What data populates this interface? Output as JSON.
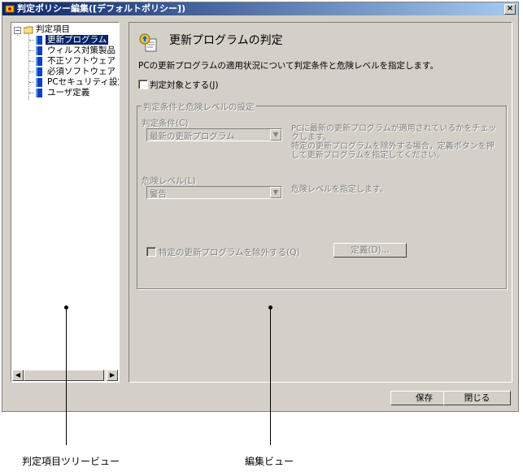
{
  "window": {
    "title": "判定ポリシー編集([デフォルトポリシー])",
    "close_glyph": "×"
  },
  "tree": {
    "root": {
      "label": "判定項目",
      "expander": "−"
    },
    "items": [
      {
        "label": "更新プログラム",
        "selected": true
      },
      {
        "label": "ウィルス対策製品",
        "selected": false
      },
      {
        "label": "不正ソフトウェア",
        "selected": false
      },
      {
        "label": "必須ソフトウェア",
        "selected": false
      },
      {
        "label": "PCセキュリティ設定",
        "selected": false
      },
      {
        "label": "ユーザ定義",
        "selected": false
      }
    ],
    "scroll_left": "◀",
    "scroll_right": "▶"
  },
  "edit": {
    "title": "更新プログラムの判定",
    "description": "PCの更新プログラムの適用状況について判定条件と危険レベルを指定します。",
    "enable_checkbox": "判定対象とする(J)",
    "group_label": "判定条件と危険レベルの設定",
    "condition_label": "判定条件(C)",
    "condition_value": "最新の更新プログラム",
    "condition_help": [
      "PCに最新の更新プログラムが適用されているかをチェッ",
      "クします。",
      "特定の更新プログラムを除外する場合，定義ボタンを押",
      "して更新プログラムを指定してください。"
    ],
    "risk_label": "危険レベル(L)",
    "risk_value": "警告",
    "risk_help": "危険レベルを指定します。",
    "exclude_checkbox": "特定の更新プログラムを除外する(Q)",
    "define_button": "定義(D)..."
  },
  "footer": {
    "save_button": "保存",
    "close_button": "閉じる"
  },
  "annotations": {
    "tree_caption": "判定項目ツリービュー",
    "edit_caption": "編集ビュー"
  },
  "colors": {
    "title_bar": "#0a246a",
    "selection": "#0a246a",
    "face": "#d4d0c8"
  }
}
